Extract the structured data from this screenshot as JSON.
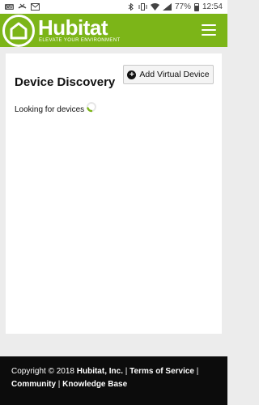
{
  "status_bar": {
    "battery_percent": "77%",
    "time": "12:54"
  },
  "header": {
    "brand": "Hubitat",
    "tagline": "ELEVATE YOUR ENVIRONMENT"
  },
  "page": {
    "title": "Device Discovery",
    "add_button_label": "Add Virtual Device",
    "status_text": "Looking for devices"
  },
  "footer": {
    "copyright_prefix": "Copyright © 2018 ",
    "company": "Hubitat, Inc.",
    "sep": " | ",
    "links": [
      "Terms of Service",
      "Community",
      "Knowledge Base"
    ]
  },
  "colors": {
    "brand_green": "#7cb518",
    "footer_bg": "#0c0c0c"
  }
}
